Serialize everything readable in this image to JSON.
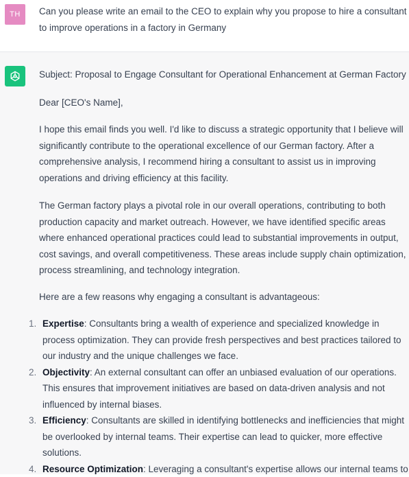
{
  "user_message": {
    "avatar_initials": "TH",
    "text": "Can you please write an email to the CEO to explain why you propose to hire a consultant to improve operations in a factory in Germany"
  },
  "assistant_message": {
    "avatar_icon": "openai-logo-icon",
    "subject": "Subject: Proposal to Engage Consultant for Operational Enhancement at German Factory",
    "greeting": "Dear [CEO's Name],",
    "paragraph1": "I hope this email finds you well. I'd like to discuss a strategic opportunity that I believe will significantly contribute to the operational excellence of our German factory. After a comprehensive analysis, I recommend hiring a consultant to assist us in improving operations and driving efficiency at this facility.",
    "paragraph2": "The German factory plays a pivotal role in our overall operations, contributing to both production capacity and market outreach. However, we have identified specific areas where enhanced operational practices could lead to substantial improvements in output, cost savings, and overall competitiveness. These areas include supply chain optimization, process streamlining, and technology integration.",
    "paragraph3": "Here are a few reasons why engaging a consultant is advantageous:",
    "reasons": [
      {
        "num": "1.",
        "title": "Expertise",
        "text": ": Consultants bring a wealth of experience and specialized knowledge in process optimization. They can provide fresh perspectives and best practices tailored to our industry and the unique challenges we face."
      },
      {
        "num": "2.",
        "title": "Objectivity",
        "text": ": An external consultant can offer an unbiased evaluation of our operations. This ensures that improvement initiatives are based on data-driven analysis and not influenced by internal biases."
      },
      {
        "num": "3.",
        "title": "Efficiency",
        "text": ": Consultants are skilled in identifying bottlenecks and inefficiencies that might be overlooked by internal teams. Their expertise can lead to quicker, more effective solutions."
      },
      {
        "num": "4.",
        "title": "Resource Optimization",
        "text": ": Leveraging a consultant's expertise allows our internal teams to"
      }
    ]
  },
  "colors": {
    "user_avatar": "#e58bc2",
    "assistant_avatar": "#19c37d",
    "assistant_bg": "#f7f7f8"
  }
}
